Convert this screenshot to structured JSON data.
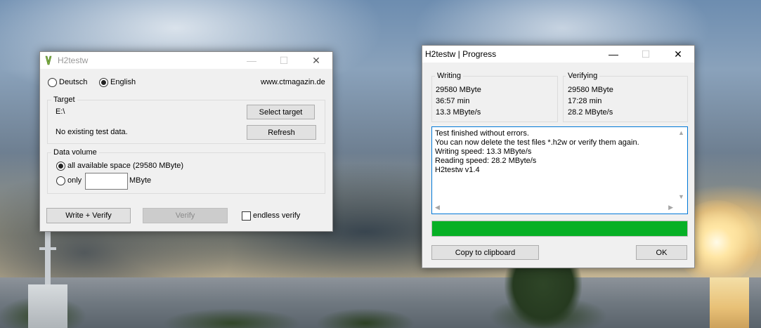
{
  "main_window": {
    "title": "H2testw",
    "controls": {
      "minimize": "—",
      "maximize": "☐",
      "close": "✕"
    },
    "language": {
      "deutsch": "Deutsch",
      "english": "English",
      "selected": "English"
    },
    "website": "www.ctmagazin.de",
    "target": {
      "group_title": "Target",
      "path": "E:\\",
      "status": "No existing test data.",
      "select_button": "Select target",
      "refresh_button": "Refresh"
    },
    "data_volume": {
      "group_title": "Data volume",
      "all_space_label": "all available space (29580 MByte)",
      "only_label": "only",
      "only_value": "",
      "unit": "MByte",
      "selected": "all"
    },
    "write_verify_button": "Write + Verify",
    "verify_button": "Verify",
    "endless_verify_label": "endless verify",
    "endless_verify_checked": false
  },
  "progress_window": {
    "title": "H2testw | Progress",
    "controls": {
      "minimize": "—",
      "maximize": "☐",
      "close": "✕"
    },
    "writing": {
      "group_title": "Writing",
      "size": "29580 MByte",
      "time": "36:57 min",
      "speed": "13.3 MByte/s"
    },
    "verifying": {
      "group_title": "Verifying",
      "size": "29580 MByte",
      "time": "17:28 min",
      "speed": "28.2 MByte/s"
    },
    "log": [
      "Test finished without errors.",
      "You can now delete the test files *.h2w or verify them again.",
      "Writing speed: 13.3 MByte/s",
      "Reading speed: 28.2 MByte/s",
      "H2testw v1.4"
    ],
    "scroll_arrows": {
      "up": "▲",
      "down": "▼",
      "left": "◀",
      "right": "▶"
    },
    "progress_percent": 100,
    "progress_color": "#06b025",
    "copy_button": "Copy to clipboard",
    "ok_button": "OK"
  }
}
